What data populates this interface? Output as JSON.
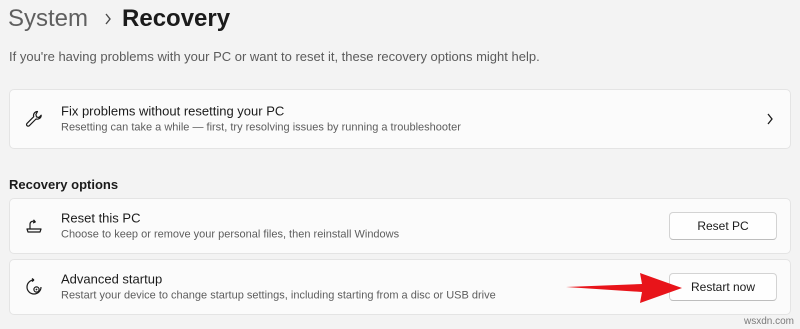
{
  "breadcrumb": {
    "parent": "System",
    "current": "Recovery"
  },
  "intro": "If you're having problems with your PC or want to reset it, these recovery options might help.",
  "fix_card": {
    "icon": "wrench-icon",
    "title": "Fix problems without resetting your PC",
    "subtitle": "Resetting can take a while — first, try resolving issues by running a troubleshooter"
  },
  "section_title": "Recovery options",
  "reset_card": {
    "icon": "reset-pc-icon",
    "title": "Reset this PC",
    "subtitle": "Choose to keep or remove your personal files, then reinstall Windows",
    "button": "Reset PC"
  },
  "advanced_card": {
    "icon": "advanced-startup-icon",
    "title": "Advanced startup",
    "subtitle": "Restart your device to change startup settings, including starting from a disc or USB drive",
    "button": "Restart now"
  },
  "annotation": {
    "arrow_color": "#e8141a"
  },
  "watermark": "wsxdn.com"
}
